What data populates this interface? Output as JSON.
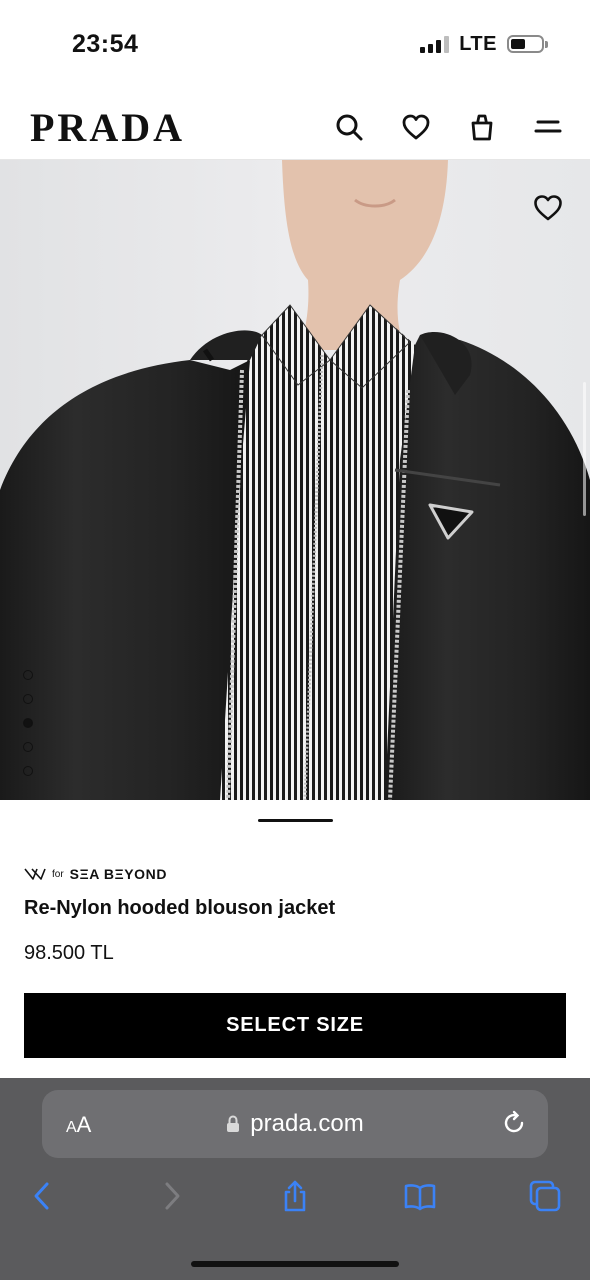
{
  "status_bar": {
    "time": "23:54",
    "network": "LTE",
    "signal_bars_active": 3,
    "signal_bars_total": 4,
    "battery_level": 0.4
  },
  "header": {
    "logo": "PRADA",
    "icons": [
      "search-icon",
      "heart-icon",
      "shopping-bag-icon",
      "menu-icon"
    ]
  },
  "gallery": {
    "image_count": 5,
    "active_index": 2,
    "favorite_icon": "heart-icon"
  },
  "product": {
    "badge_for": "for",
    "badge_brand": "SΞA BΞYOND",
    "name": "Re-Nylon hooded blouson jacket",
    "price": "98.500 TL",
    "cta_label": "SELECT SIZE"
  },
  "browser": {
    "text_size_label_big": "A",
    "text_size_label_small": "A",
    "url": "prada.com",
    "toolbar_icons": [
      "back-icon",
      "forward-icon",
      "share-icon",
      "bookmarks-icon",
      "tabs-icon"
    ]
  },
  "colors": {
    "accent_blue": "#3b82f6",
    "cta_background": "#000000",
    "browser_bar": "#5b5b5d"
  }
}
